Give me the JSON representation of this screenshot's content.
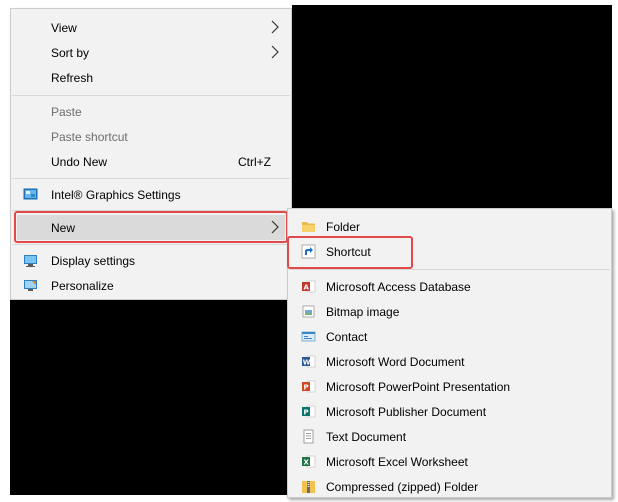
{
  "context_menu": {
    "items": [
      {
        "label": "View",
        "has_submenu": true
      },
      {
        "label": "Sort by",
        "has_submenu": true
      },
      {
        "label": "Refresh"
      },
      {
        "label": "Paste",
        "disabled": true
      },
      {
        "label": "Paste shortcut",
        "disabled": true
      },
      {
        "label": "Undo New",
        "shortcut": "Ctrl+Z"
      },
      {
        "label": "Intel® Graphics Settings",
        "icon": "intel-graphics-icon"
      },
      {
        "label": "New",
        "has_submenu": true,
        "highlighted": true
      },
      {
        "label": "Display settings",
        "icon": "display-icon"
      },
      {
        "label": "Personalize",
        "icon": "personalize-icon"
      }
    ]
  },
  "new_submenu": {
    "items": [
      {
        "label": "Folder",
        "icon": "folder-icon"
      },
      {
        "label": "Shortcut",
        "icon": "shortcut-icon",
        "highlighted": true
      },
      {
        "label": "Microsoft Access Database",
        "icon": "access-icon"
      },
      {
        "label": "Bitmap image",
        "icon": "bitmap-icon"
      },
      {
        "label": "Contact",
        "icon": "contact-icon"
      },
      {
        "label": "Microsoft Word Document",
        "icon": "word-icon"
      },
      {
        "label": "Microsoft PowerPoint Presentation",
        "icon": "powerpoint-icon"
      },
      {
        "label": "Microsoft Publisher Document",
        "icon": "publisher-icon"
      },
      {
        "label": "Text Document",
        "icon": "text-document-icon"
      },
      {
        "label": "Microsoft Excel Worksheet",
        "icon": "excel-icon"
      },
      {
        "label": "Compressed (zipped) Folder",
        "icon": "zip-folder-icon"
      }
    ]
  },
  "colors": {
    "menu_background": "#f2f2f2",
    "hover_highlight": "#dadada",
    "annotation_red": "#e04a4a",
    "desktop_black": "#000000"
  }
}
